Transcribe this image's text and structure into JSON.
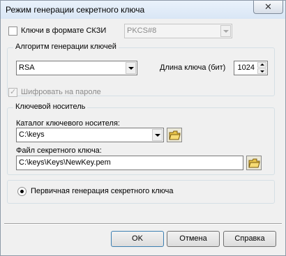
{
  "window": {
    "title": "Режим генерации секретного ключа",
    "close_glyph": "✕"
  },
  "skzi": {
    "checkbox_label": "Ключи в формате СКЗИ",
    "checked": false,
    "format_value": "PKCS#8"
  },
  "algorithm_group": {
    "title": "Алгоритм генерации ключей",
    "algorithm_value": "RSA",
    "key_length_label": "Длина ключа (бит)",
    "key_length_value": "1024"
  },
  "password_encrypt": {
    "label": "Шифровать на пароле",
    "checked": true,
    "disabled": true
  },
  "key_media_group": {
    "title": "Ключевой носитель",
    "catalog_label": "Каталог ключевого носителя:",
    "catalog_value": "C:\\keys",
    "file_label": "Файл секретного ключа:",
    "file_value": "C:\\keys\\Keys\\NewKey.pem"
  },
  "generation_mode": {
    "radio_label": "Первичная генерация секретного ключа",
    "selected": true
  },
  "buttons": {
    "ok": "OK",
    "cancel": "Отмена",
    "help": "Справка"
  }
}
